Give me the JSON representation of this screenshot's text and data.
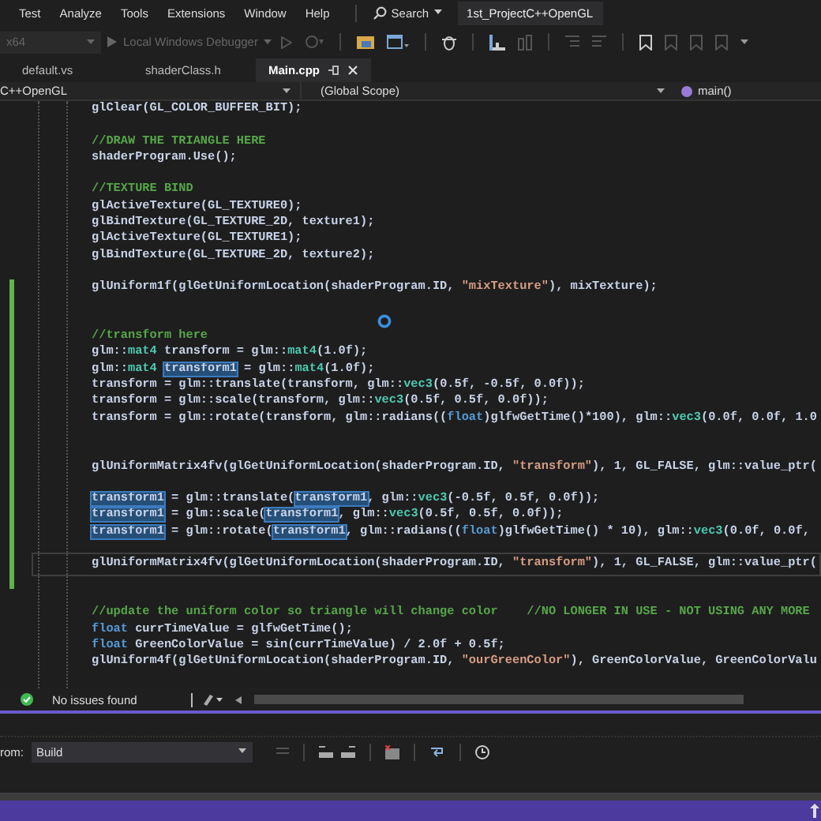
{
  "menu": [
    "Test",
    "Analyze",
    "Tools",
    "Extensions",
    "Window",
    "Help"
  ],
  "search": {
    "label": "Search"
  },
  "project_title": "1st_ProjectC++OpenGL",
  "toolbar": {
    "platform": "x64",
    "debugger": "Local Windows Debugger",
    "disabled": true
  },
  "tabs": [
    {
      "label": "default.vs",
      "selected": false
    },
    {
      "label": "shaderClass.h",
      "selected": false
    },
    {
      "label": "Main.cpp",
      "selected": true
    }
  ],
  "navigation": {
    "project": "C++OpenGL",
    "scope": "(Global Scope)",
    "member": "main()"
  },
  "code_lines": [
    {
      "kind": "code",
      "modified": false,
      "current": false,
      "segments": [
        {
          "kind": "plain",
          "text": "glClear(GL_COLOR_BUFFER_BIT);"
        }
      ]
    },
    {
      "kind": "blank",
      "modified": false
    },
    {
      "kind": "code",
      "modified": false,
      "current": false,
      "segments": [
        {
          "kind": "comment",
          "text": "//DRAW THE TRIANGLE HERE"
        }
      ]
    },
    {
      "kind": "code",
      "modified": false,
      "current": false,
      "segments": [
        {
          "kind": "plain",
          "text": "shaderProgram.Use();"
        }
      ]
    },
    {
      "kind": "blank",
      "modified": false
    },
    {
      "kind": "code",
      "modified": false,
      "current": false,
      "segments": [
        {
          "kind": "comment",
          "text": "//TEXTURE BIND"
        }
      ]
    },
    {
      "kind": "code",
      "modified": false,
      "current": false,
      "segments": [
        {
          "kind": "plain",
          "text": "glActiveTexture(GL_TEXTURE0);"
        }
      ]
    },
    {
      "kind": "code",
      "modified": false,
      "current": false,
      "segments": [
        {
          "kind": "plain",
          "text": "glBindTexture(GL_TEXTURE_2D, texture1);"
        }
      ]
    },
    {
      "kind": "code",
      "modified": false,
      "current": false,
      "segments": [
        {
          "kind": "plain",
          "text": "glActiveTexture(GL_TEXTURE1);"
        }
      ]
    },
    {
      "kind": "code",
      "modified": false,
      "current": false,
      "segments": [
        {
          "kind": "plain",
          "text": "glBindTexture(GL_TEXTURE_2D, texture2);"
        }
      ]
    },
    {
      "kind": "blank",
      "modified": false
    },
    {
      "kind": "code",
      "modified": true,
      "current": false,
      "segments": [
        {
          "kind": "plain",
          "text": "glUniform1f(glGetUniformLocation(shaderProgram.ID, "
        },
        {
          "kind": "string",
          "text": "\"mixTexture\""
        },
        {
          "kind": "plain",
          "text": "), mixTexture);"
        }
      ]
    },
    {
      "kind": "blank",
      "modified": true
    },
    {
      "kind": "blank",
      "modified": true
    },
    {
      "kind": "code",
      "modified": true,
      "current": false,
      "segments": [
        {
          "kind": "comment",
          "text": "//transform here"
        }
      ]
    },
    {
      "kind": "code",
      "modified": true,
      "current": false,
      "segments": [
        {
          "kind": "plain",
          "text": "glm::"
        },
        {
          "kind": "type",
          "text": "mat4"
        },
        {
          "kind": "plain",
          "text": " transform = glm::"
        },
        {
          "kind": "type",
          "text": "mat4"
        },
        {
          "kind": "plain",
          "text": "(1.0f);"
        }
      ]
    },
    {
      "kind": "code",
      "modified": true,
      "current": false,
      "segments": [
        {
          "kind": "plain",
          "text": "glm::"
        },
        {
          "kind": "type",
          "text": "mat4 "
        },
        {
          "kind": "match",
          "text": "transform1"
        },
        {
          "kind": "plain",
          "text": " = glm::"
        },
        {
          "kind": "type",
          "text": "mat4"
        },
        {
          "kind": "plain",
          "text": "(1.0f);"
        }
      ]
    },
    {
      "kind": "code",
      "modified": true,
      "current": false,
      "segments": [
        {
          "kind": "plain",
          "text": "transform = glm::translate(transform, glm::"
        },
        {
          "kind": "type",
          "text": "vec3"
        },
        {
          "kind": "plain",
          "text": "(0.5f, -0.5f, 0.0f));"
        }
      ]
    },
    {
      "kind": "code",
      "modified": true,
      "current": false,
      "segments": [
        {
          "kind": "plain",
          "text": "transform = glm::scale(transform, glm::"
        },
        {
          "kind": "type",
          "text": "vec3"
        },
        {
          "kind": "plain",
          "text": "(0.5f, 0.5f, 0.0f));"
        }
      ]
    },
    {
      "kind": "code",
      "modified": true,
      "current": false,
      "segments": [
        {
          "kind": "plain",
          "text": "transform = glm::rotate(transform, glm::radians(("
        },
        {
          "kind": "keyword",
          "text": "float"
        },
        {
          "kind": "plain",
          "text": ")glfwGetTime()*100), glm::"
        },
        {
          "kind": "type",
          "text": "vec3"
        },
        {
          "kind": "plain",
          "text": "(0.0f, 0.0f, 1.0"
        }
      ]
    },
    {
      "kind": "blank",
      "modified": true
    },
    {
      "kind": "blank",
      "modified": true
    },
    {
      "kind": "code",
      "modified": true,
      "current": false,
      "segments": [
        {
          "kind": "plain",
          "text": "glUniformMatrix4fv(glGetUniformLocation(shaderProgram.ID, "
        },
        {
          "kind": "string",
          "text": "\"transform\""
        },
        {
          "kind": "plain",
          "text": "), 1, GL_FALSE, glm::value_ptr("
        }
      ]
    },
    {
      "kind": "blank",
      "modified": true
    },
    {
      "kind": "code",
      "modified": true,
      "current": false,
      "segments": [
        {
          "kind": "match",
          "text": "transform1"
        },
        {
          "kind": "plain",
          "text": " = glm::translate("
        },
        {
          "kind": "match",
          "text": "transform1"
        },
        {
          "kind": "plain",
          "text": ", glm::"
        },
        {
          "kind": "type",
          "text": "vec3"
        },
        {
          "kind": "plain",
          "text": "(-0.5f, 0.5f, 0.0f));"
        }
      ]
    },
    {
      "kind": "code",
      "modified": true,
      "current": false,
      "segments": [
        {
          "kind": "match",
          "text": "transform1"
        },
        {
          "kind": "plain",
          "text": " = glm::scale("
        },
        {
          "kind": "match",
          "text": "transform1"
        },
        {
          "kind": "plain",
          "text": ", glm::"
        },
        {
          "kind": "type",
          "text": "vec3"
        },
        {
          "kind": "plain",
          "text": "(0.5f, 0.5f, 0.0f));"
        }
      ]
    },
    {
      "kind": "code",
      "modified": true,
      "current": false,
      "segments": [
        {
          "kind": "match",
          "text": "transform1"
        },
        {
          "kind": "plain",
          "text": " = glm::rotate("
        },
        {
          "kind": "match",
          "text": "transform1"
        },
        {
          "kind": "plain",
          "text": ", glm::radians(("
        },
        {
          "kind": "keyword",
          "text": "float"
        },
        {
          "kind": "plain",
          "text": ")glfwGetTime() * 10), glm::"
        },
        {
          "kind": "type",
          "text": "vec3"
        },
        {
          "kind": "plain",
          "text": "(0.0f, 0.0f,"
        }
      ]
    },
    {
      "kind": "blank",
      "modified": true
    },
    {
      "kind": "code",
      "modified": true,
      "current": true,
      "segments": [
        {
          "kind": "plain",
          "text": "glUniformMatrix4fv(glGetUniformLocation(shaderProgram.ID, "
        },
        {
          "kind": "string",
          "text": "\"transform\""
        },
        {
          "kind": "plain",
          "text": "), 1, GL_FALSE, glm::value_ptr("
        }
      ]
    },
    {
      "kind": "blank",
      "modified": true
    },
    {
      "kind": "blank",
      "modified": false
    },
    {
      "kind": "code",
      "modified": false,
      "current": false,
      "segments": [
        {
          "kind": "comment",
          "text": "//update the uniform color so triangle will change color    //NO LONGER IN USE - NOT USING ANY MORE"
        }
      ]
    },
    {
      "kind": "code",
      "modified": false,
      "current": false,
      "segments": [
        {
          "kind": "keyword",
          "text": "float"
        },
        {
          "kind": "plain",
          "text": " currTimeValue = glfwGetTime();"
        }
      ]
    },
    {
      "kind": "code",
      "modified": false,
      "current": false,
      "segments": [
        {
          "kind": "keyword",
          "text": "float"
        },
        {
          "kind": "plain",
          "text": " GreenColorValue = sin(currTimeValue) / 2.0f + 0.5f;"
        }
      ]
    },
    {
      "kind": "code",
      "modified": false,
      "current": false,
      "segments": [
        {
          "kind": "plain",
          "text": "glUniform4f(glGetUniformLocation(shaderProgram.ID, "
        },
        {
          "kind": "string",
          "text": "\"ourGreenColor\""
        },
        {
          "kind": "plain",
          "text": "), GreenColorValue, GreenColorValu"
        }
      ]
    },
    {
      "kind": "blank",
      "modified": false
    }
  ],
  "status": {
    "issues": "No issues found"
  },
  "output": {
    "label": "rom:",
    "source": "Build"
  }
}
